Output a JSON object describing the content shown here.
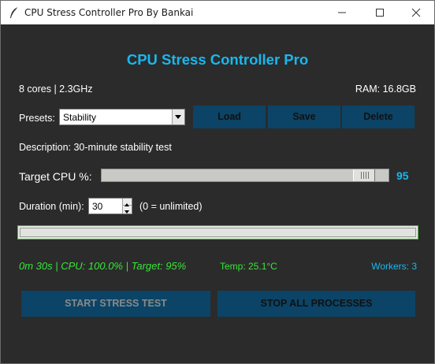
{
  "window": {
    "title": "CPU Stress Controller Pro By Bankai",
    "icon": "feather-icon"
  },
  "header": {
    "title": "CPU Stress Controller Pro"
  },
  "system": {
    "cores_clock": "8 cores | 2.3GHz",
    "ram": "RAM: 16.8GB"
  },
  "presets": {
    "label": "Presets:",
    "selected": "Stability",
    "load_label": "Load",
    "save_label": "Save",
    "delete_label": "Delete"
  },
  "description": "Description: 30-minute stability test",
  "target_cpu": {
    "label": "Target CPU %:",
    "value": 95,
    "value_text": "95",
    "min": 0,
    "max": 100
  },
  "duration": {
    "label": "Duration (min):",
    "value": "30",
    "hint": "(0 = unlimited)"
  },
  "progress": {
    "value": 1.0
  },
  "status": {
    "runtime": "0m 30s | CPU: 100.0% | Target: 95%",
    "temp": "Temp: 25.1°C",
    "workers": "Workers: 3"
  },
  "actions": {
    "start_label": "START STRESS TEST",
    "stop_label": "STOP ALL PROCESSES"
  },
  "colors": {
    "accent": "#19b8ee",
    "status_green": "#37e637",
    "button_bg": "#0b4466",
    "window_bg": "#2b2b2b"
  }
}
